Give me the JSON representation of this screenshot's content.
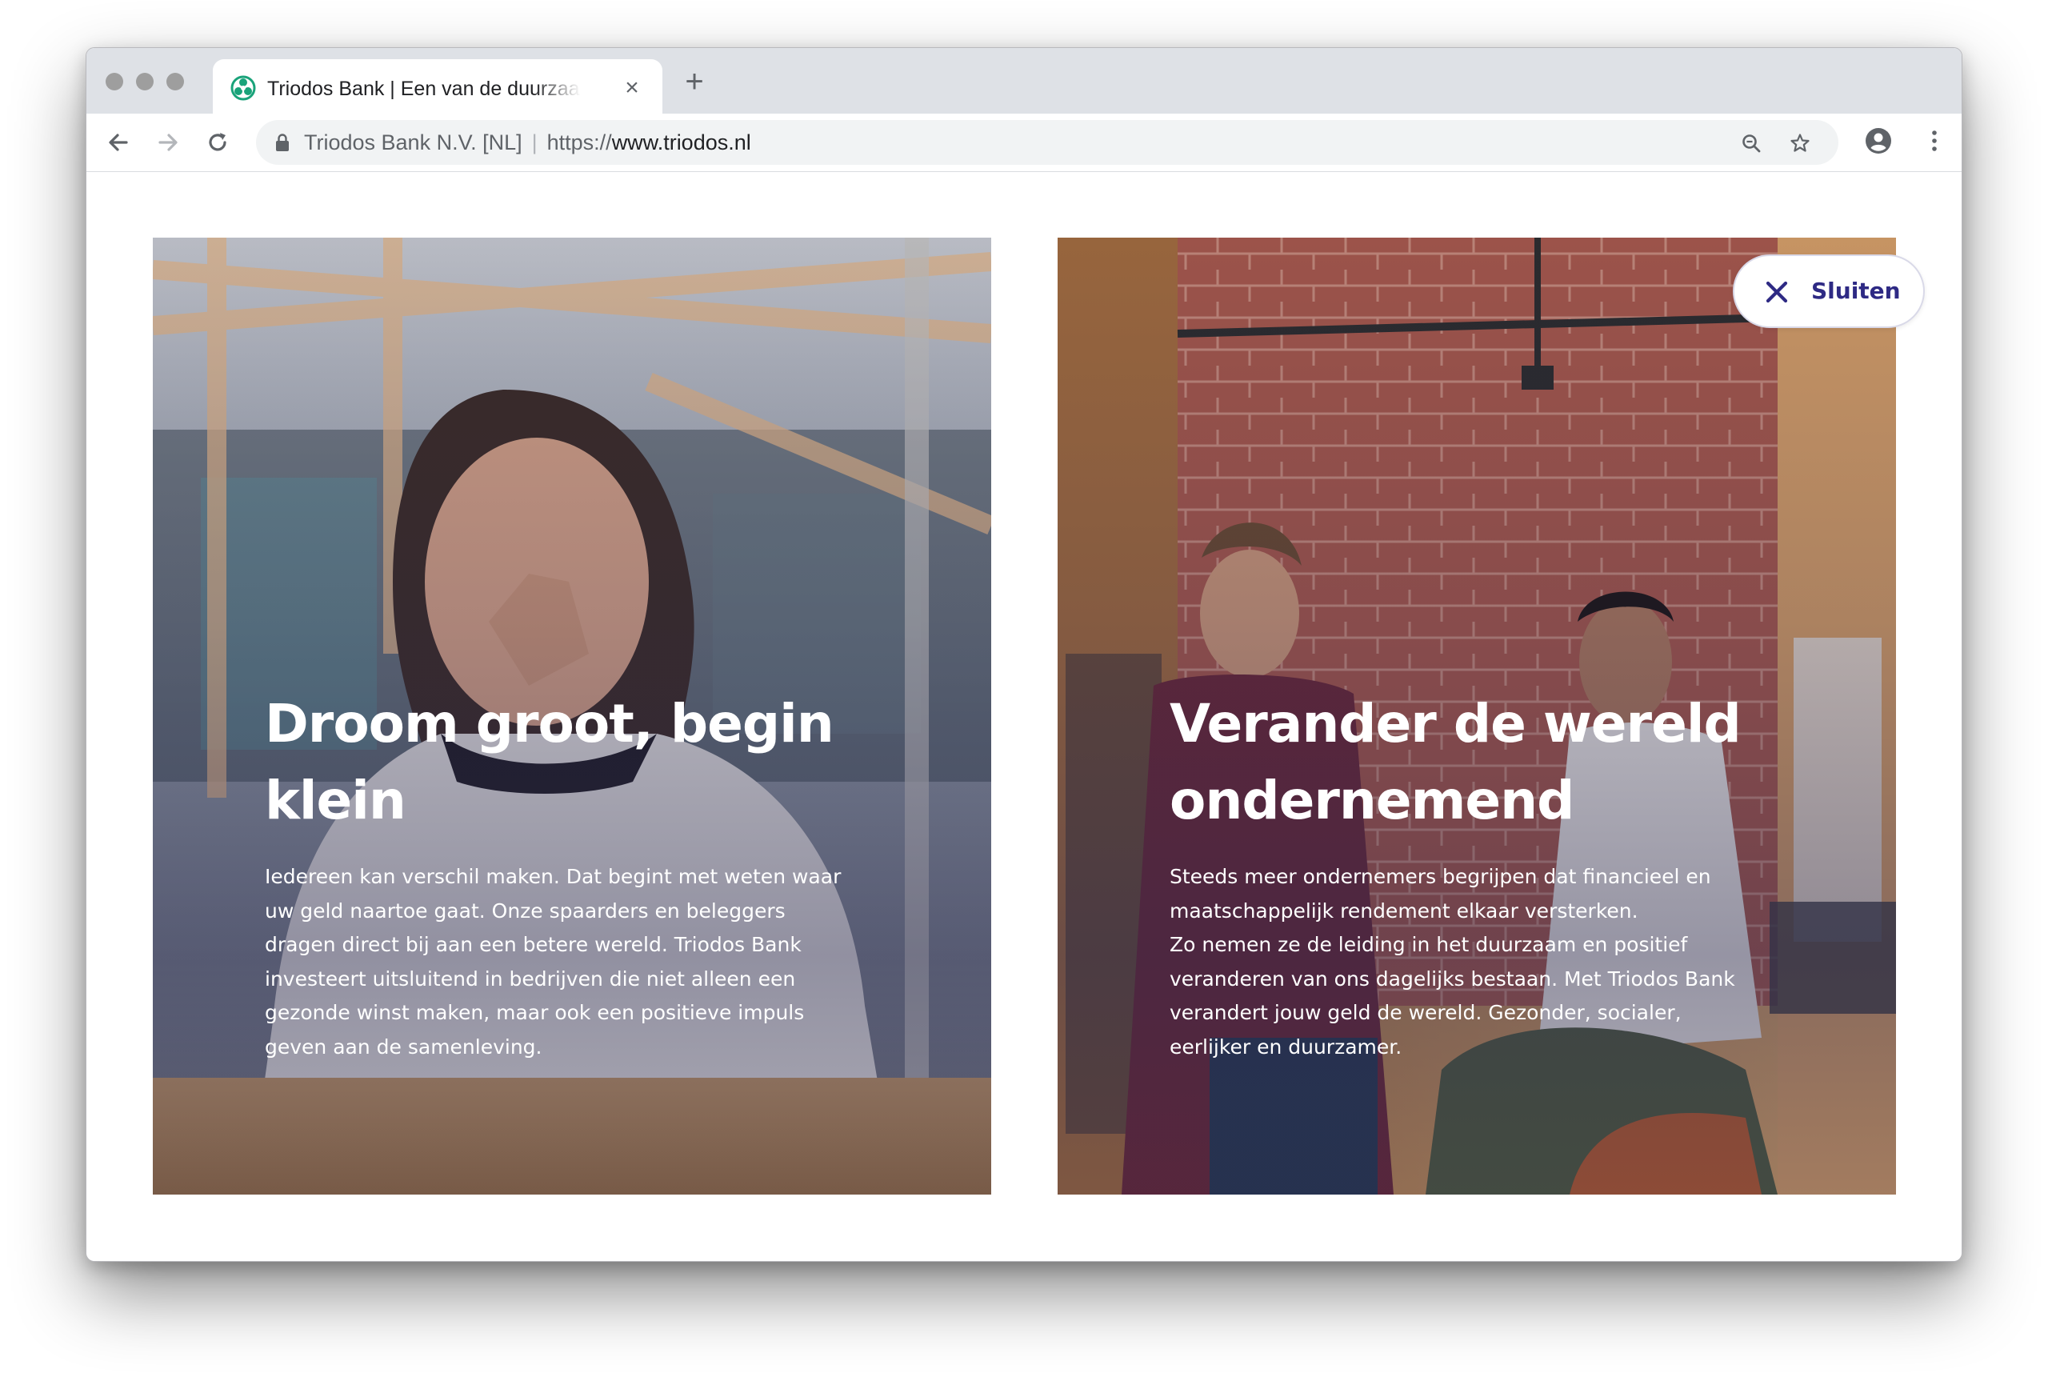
{
  "browser": {
    "tab": {
      "title": "Triodos Bank | Een van de duurzaamste banken ter wereld",
      "close_glyph": "×"
    },
    "new_tab_glyph": "+",
    "address": {
      "certificate_owner": "Triodos Bank N.V. [NL]",
      "separator": "|",
      "url_scheme": "https://",
      "url_host": "www.triodos.nl"
    },
    "icons": [
      "back-arrow-icon",
      "forward-arrow-icon",
      "reload-icon",
      "lock-icon",
      "zoom-icon",
      "bookmark-star-icon",
      "account-icon",
      "more-vert-icon"
    ]
  },
  "page": {
    "close_button": {
      "label": "Sluiten",
      "icon": "close-icon",
      "color": "#2e2a84"
    },
    "cards": [
      {
        "heading": "Droom groot, begin klein",
        "body": "Iedereen kan verschil maken. Dat begint met weten waar\nuw geld naartoe gaat. Onze spaarders en beleggers\ndragen direct bij aan een betere wereld. Triodos Bank\ninvesteert uitsluitend in bedrijven die niet alleen een\ngezonde winst maken, maar ook een positieve impuls\ngeven aan de samenleving."
      },
      {
        "heading": "Verander de wereld ondernemend",
        "body": "Steeds meer ondernemers begrijpen dat financieel en\nmaatschappelijk rendement elkaar versterken.\nZo nemen ze de leiding in het duurzaam en positief\nveranderen van ons dagelijks bestaan. Met Triodos Bank\nverandert jouw geld de wereld. Gezonder, socialer,\neerlijker en duurzamer."
      }
    ]
  },
  "colors": {
    "tabstrip": "#dee1e6",
    "omnibox": "#f1f3f4",
    "brand": "#2e2a84",
    "favicon": "#1aa37a"
  }
}
